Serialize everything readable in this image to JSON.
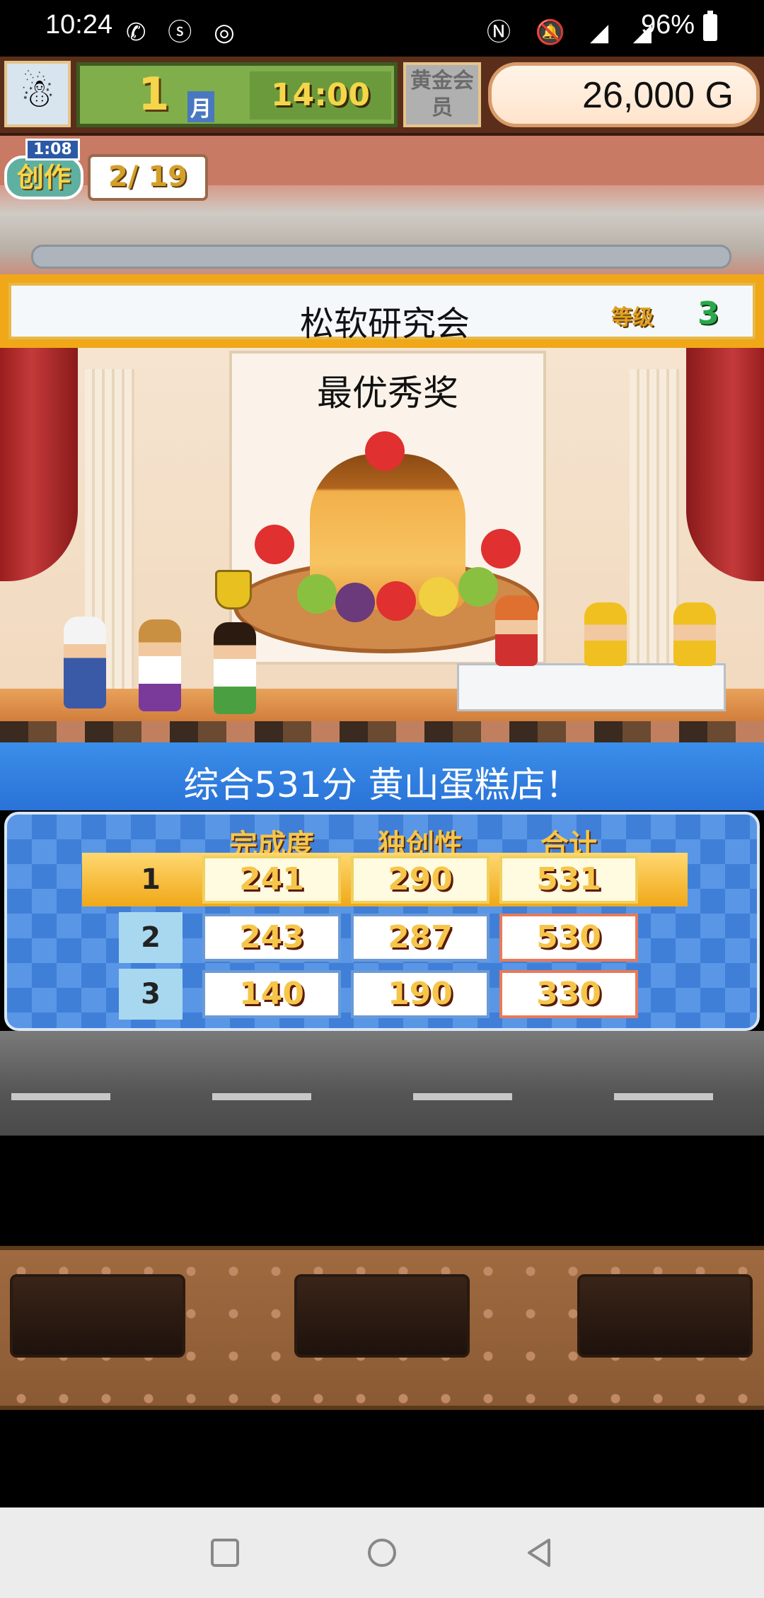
{
  "status_bar": {
    "time": "10:24",
    "battery": "96%"
  },
  "hud": {
    "month": "1",
    "month_label": "月",
    "clock": "14:00",
    "gold_member": "黄金会员",
    "money": "26,000 G"
  },
  "create": {
    "timer": "1:08",
    "label": "创作",
    "count": "2/ 19"
  },
  "contest": {
    "name": "松软研究会",
    "level_label": "等级",
    "level": "3",
    "award": "最优秀奖",
    "result": "综合531分 黄山蛋糕店！"
  },
  "scores": {
    "headers": [
      "完成度",
      "独创性",
      "合计"
    ],
    "rows": [
      {
        "rank": "1",
        "completion": "241",
        "originality": "290",
        "total": "531"
      },
      {
        "rank": "2",
        "completion": "243",
        "originality": "287",
        "total": "530"
      },
      {
        "rank": "3",
        "completion": "140",
        "originality": "190",
        "total": "330"
      }
    ]
  },
  "colors": {
    "banner_gold": "#f0a818",
    "result_blue": "#2a72d8",
    "score_text": "#f5c64a"
  }
}
